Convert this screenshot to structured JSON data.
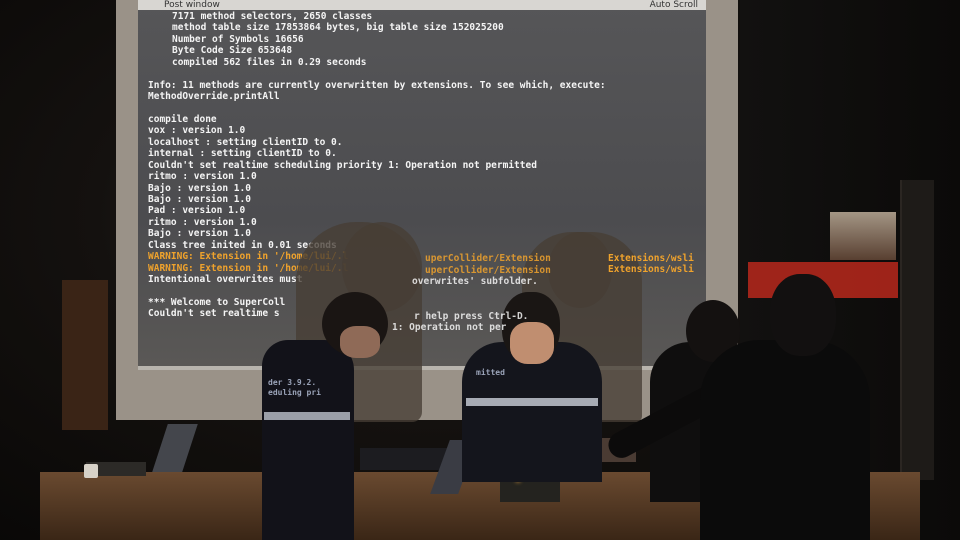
{
  "post_window": {
    "title": "Post window",
    "auto_scroll": "Auto Scroll",
    "lines": [
      {
        "text": "7171 method selectors, 2650 classes",
        "indent": true
      },
      {
        "text": "method table size 17853864 bytes, big table size 152025200",
        "indent": true
      },
      {
        "text": "Number of Symbols 16656",
        "indent": true
      },
      {
        "text": "Byte Code Size 653648",
        "indent": true
      },
      {
        "text": "compiled 562 files in 0.29 seconds",
        "indent": true
      },
      {
        "text": ""
      },
      {
        "text": "Info: 11 methods are currently overwritten by extensions. To see which, execute:"
      },
      {
        "text": "MethodOverride.printAll"
      },
      {
        "text": ""
      },
      {
        "text": "compile done"
      },
      {
        "text": "vox : version 1.0"
      },
      {
        "text": "localhost : setting clientID to 0."
      },
      {
        "text": "internal : setting clientID to 0."
      },
      {
        "text": "Couldn't set realtime scheduling priority 1: Operation not permitted"
      },
      {
        "text": "ritmo : version 1.0"
      },
      {
        "text": "Bajo : version 1.0"
      },
      {
        "text": "Bajo : version 1.0"
      },
      {
        "text": "Pad : version 1.0"
      },
      {
        "text": "ritmo : version 1.0"
      },
      {
        "text": "Bajo : version 1.0"
      },
      {
        "text": "Class tree inited in 0.01 seconds"
      },
      {
        "text": "WARNING: Extension in '/home/lui/.l",
        "warn": true
      },
      {
        "text": "WARNING: Extension in '/home/lui/.l",
        "warn": true
      },
      {
        "text": "Intentional overwrites must"
      },
      {
        "text": ""
      },
      {
        "text": "*** Welcome to SuperColl"
      },
      {
        "text": "Couldn't set realtime s"
      }
    ],
    "occluded_fragments": [
      "uperCollider/Extension",
      "uperCollider/Extension",
      "overwrites' subfolder.",
      "r help press Ctrl-D.",
      "1: Operation not per"
    ],
    "right_fragments": [
      "Extensions/wsli",
      "Extensions/wsli"
    ]
  },
  "laptop_screen_fragments": [
    "der 3.9.2.",
    "eduling pri",
    "mitted"
  ],
  "colors": {
    "post_text": "#f4f4f4",
    "warning": "#f0a32c",
    "screen_bg": "#4f4f52",
    "accent_red": "#b8281c"
  }
}
